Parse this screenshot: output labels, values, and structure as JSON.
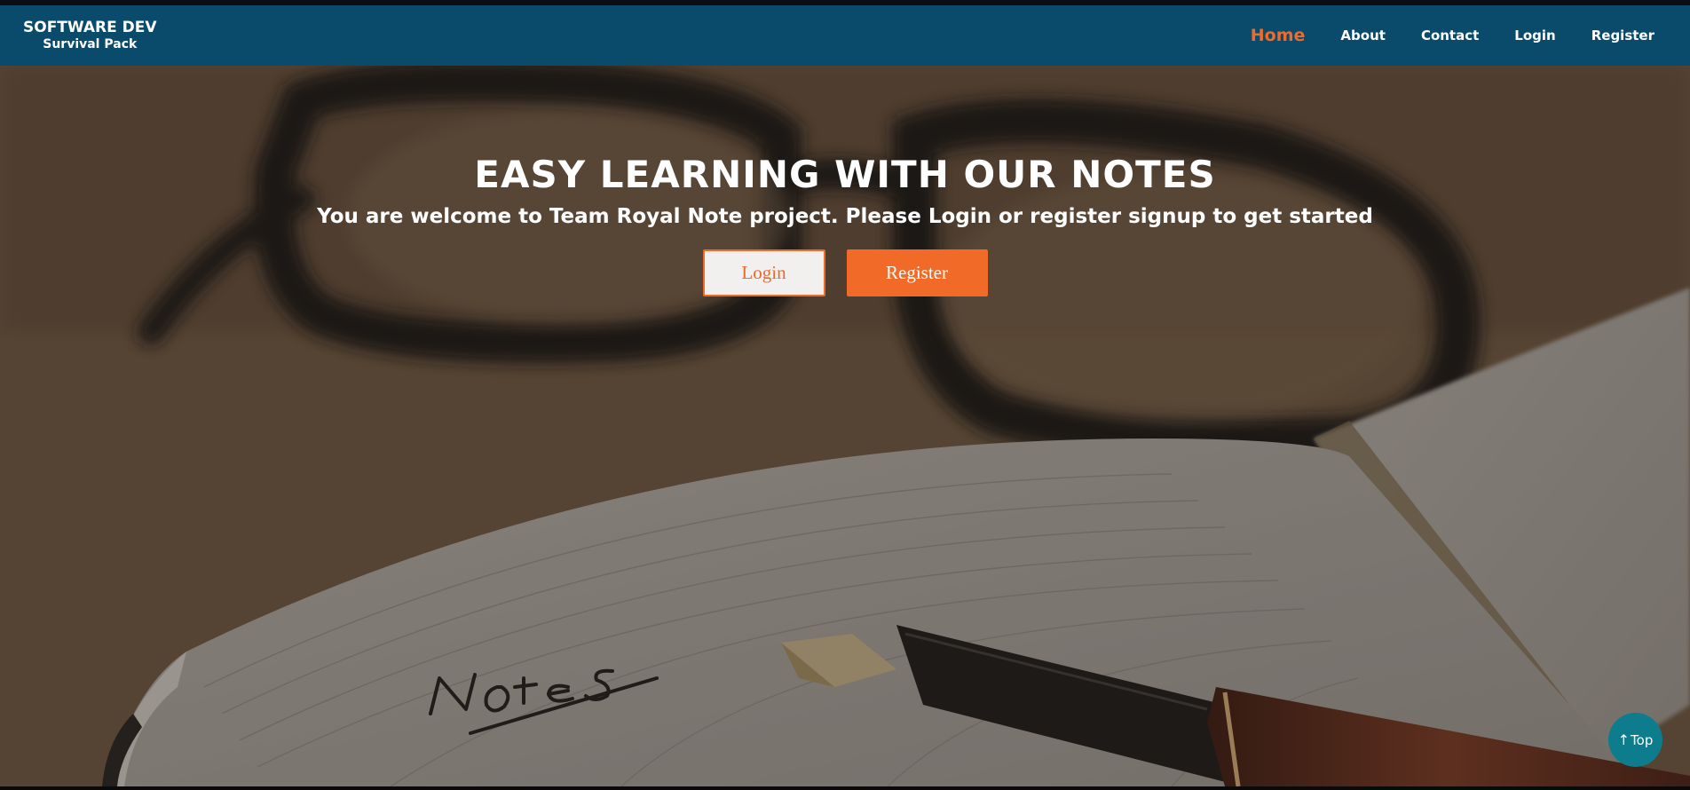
{
  "brand": {
    "title": "SOFTWARE DEV",
    "subtitle": "Survival Pack"
  },
  "nav": {
    "items": [
      {
        "label": "Home",
        "active": true
      },
      {
        "label": "About",
        "active": false
      },
      {
        "label": "Contact",
        "active": false
      },
      {
        "label": "Login",
        "active": false
      },
      {
        "label": "Register",
        "active": false
      }
    ]
  },
  "hero": {
    "title": "EASY LEARNING WITH OUR NOTES",
    "subtitle": "You are welcome to Team Royal Note project. Please Login or register signup to get started",
    "login_label": "Login",
    "register_label": "Register",
    "notebook_text": "Notes"
  },
  "scroll_top": {
    "arrow": "↑",
    "label": "Top"
  },
  "colors": {
    "navbar": "#0a4a6a",
    "accent": "#f26a27",
    "top_button": "#0d7c8c"
  }
}
